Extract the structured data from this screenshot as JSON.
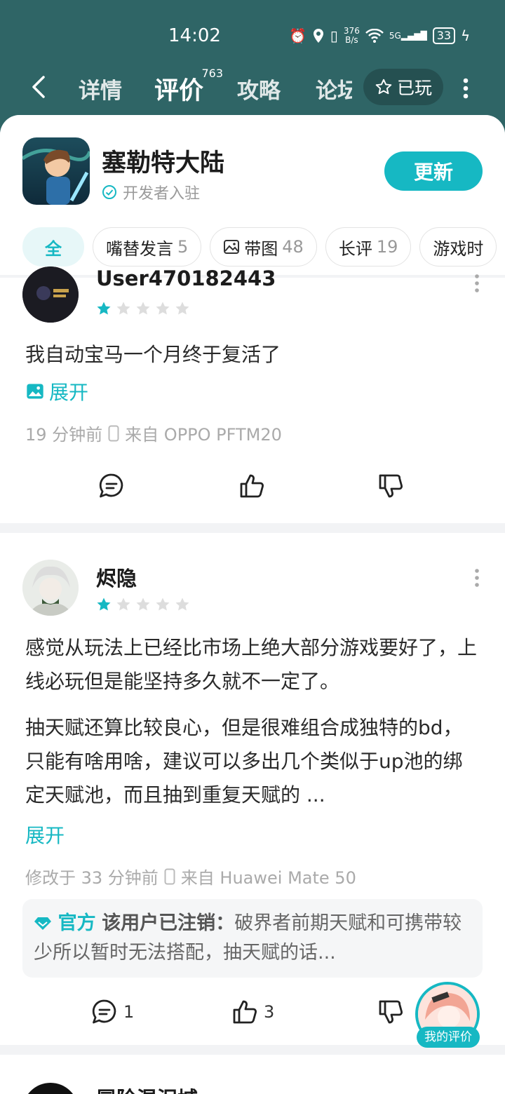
{
  "status_bar": {
    "time": "14:02",
    "net_speed_value": "376",
    "net_speed_unit": "B/s",
    "signal": "5G",
    "battery": "33"
  },
  "nav": {
    "tabs": [
      {
        "label": "详情"
      },
      {
        "label": "评价",
        "badge": "763"
      },
      {
        "label": "攻略"
      },
      {
        "label": "论坛"
      }
    ],
    "played_label": "已玩"
  },
  "game": {
    "name": "塞勒特大陆",
    "verified_label": "开发者入驻",
    "update_label": "更新"
  },
  "filters": [
    {
      "label": "全",
      "count": ""
    },
    {
      "label": "嘴替发言",
      "count": "5"
    },
    {
      "label": "带图",
      "count": "48"
    },
    {
      "label": "长评",
      "count": "19"
    },
    {
      "label": "游戏时",
      "count": ""
    }
  ],
  "reviews": [
    {
      "user": "User470182443",
      "rating": 1,
      "text": "我自动宝马一个月终于复活了",
      "expand_label": "展开",
      "time": "19 分钟前",
      "device": "来自 OPPO PFTM20",
      "comments": "",
      "likes": ""
    },
    {
      "user": "烬隐",
      "rating": 1,
      "para1": "感觉从玩法上已经比市场上绝大部分游戏要好了，上线必玩但是能坚持多久就不一定了。",
      "para2": "抽天赋还算比较良心，但是很难组合成独特的bd，只能有啥用啥，建议可以多出几个类似于up池的绑定天赋池，而且抽到重复天赋的 ...",
      "expand_label": "展开",
      "time": "修改于 33 分钟前",
      "device": "来自 Huawei Mate 50",
      "reply_official": "官方",
      "reply_user": "该用户已注销",
      "reply_text": "破界者前期天赋和可携带较少所以暂时无法搭配，抽天赋的话...",
      "comments": "1",
      "likes": "3"
    },
    {
      "user": "冒险混泥城"
    }
  ],
  "my_review_label": "我的评价",
  "colors": {
    "header": "#2f6566",
    "accent": "#16b8c3",
    "star_empty": "#dddddd"
  }
}
